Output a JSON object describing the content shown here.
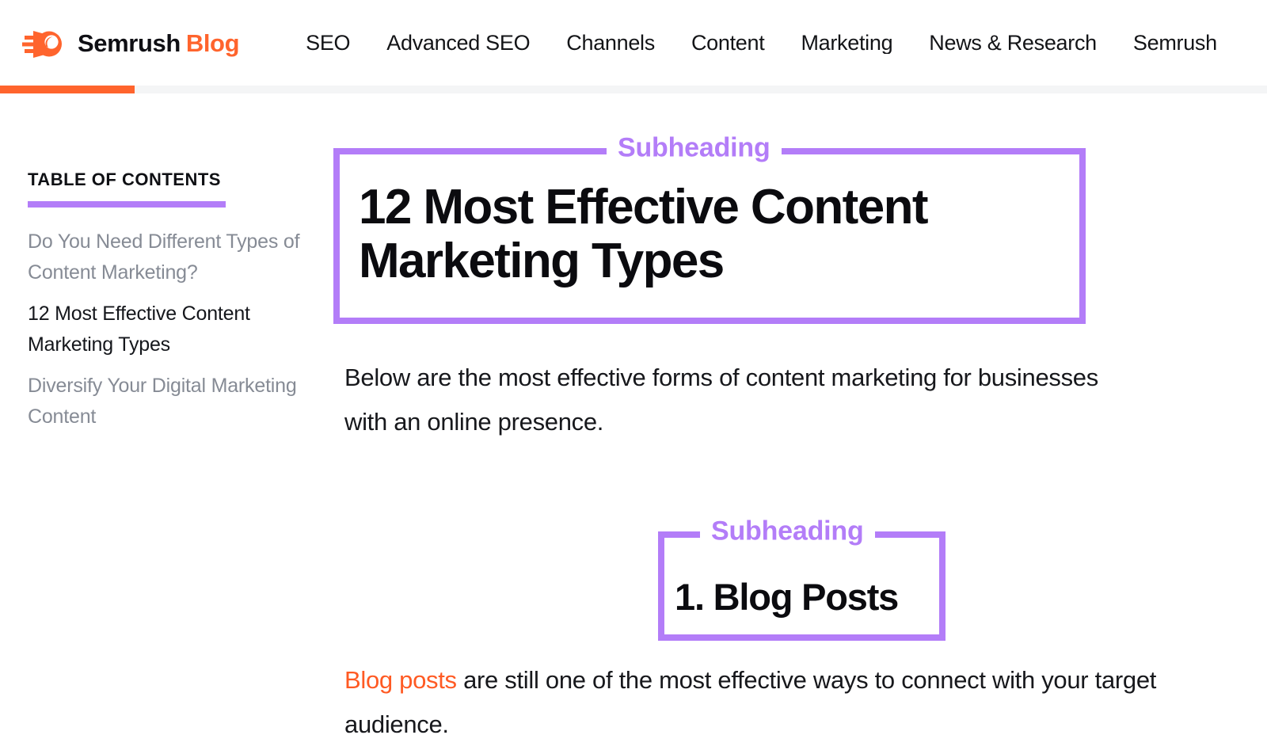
{
  "colors": {
    "brand_orange": "#ff642d",
    "link_orange": "#ff5a23",
    "annotation_purple": "#b37df8",
    "text_dark": "#0f0f14",
    "text_muted": "#868b95",
    "progress_track": "#f4f5f6",
    "background": "#ffffff"
  },
  "header": {
    "logo_icon": "semrush-comet-logo-icon",
    "brand_name": "Semrush",
    "brand_suffix": "Blog",
    "nav_items": [
      {
        "label": "SEO"
      },
      {
        "label": "Advanced SEO"
      },
      {
        "label": "Channels"
      },
      {
        "label": "Content"
      },
      {
        "label": "Marketing"
      },
      {
        "label": "News & Research"
      },
      {
        "label": "Semrush"
      }
    ],
    "reading_progress_percent": 10.6
  },
  "sidebar": {
    "title": "TABLE OF CONTENTS",
    "items": [
      {
        "label": "Do You Need Different Types of Content Marketing?",
        "active": false
      },
      {
        "label": "12 Most Effective Content Marketing Types",
        "active": true
      },
      {
        "label": "Diversify Your Digital Marketing Content",
        "active": false
      }
    ]
  },
  "article": {
    "heading_box": {
      "annotation": "Subheading",
      "heading": "12 Most Effective Content Marketing Types"
    },
    "intro_paragraph": "Below are the most effective forms of content marketing for businesses with an online presence.",
    "subsection_box": {
      "annotation": "Subheading",
      "heading": "1. Blog Posts"
    },
    "subsection_paragraph": {
      "link_text": "Blog posts",
      "rest_text": " are still one of the most effective ways to connect with your target audience."
    }
  }
}
